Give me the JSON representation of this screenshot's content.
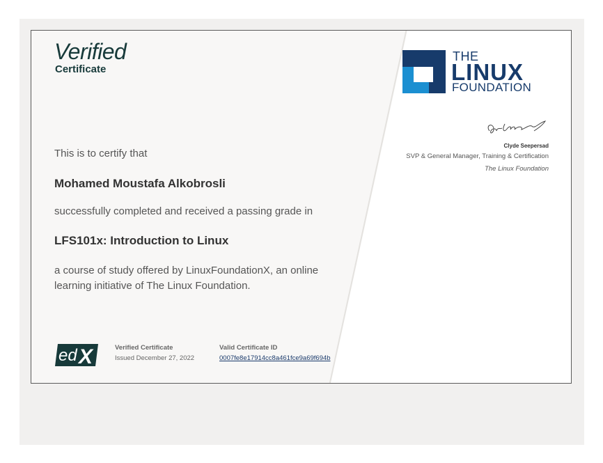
{
  "header": {
    "verified": "Verified",
    "certificate": "Certificate"
  },
  "logo": {
    "the": "THE",
    "linux": "LINUX",
    "foundation": "FOUNDATION",
    "colors": {
      "dark": "#173b6b",
      "light": "#1b8fd1"
    }
  },
  "signatory": {
    "name": "Clyde Seepersad",
    "role": "SVP & General Manager, Training & Certification",
    "org": "The Linux Foundation"
  },
  "body": {
    "certify": "This is to certify that",
    "recipient": "Mohamed Moustafa Alkobrosli",
    "completed": "successfully completed and received a passing grade in",
    "course": "LFS101x: Introduction to Linux",
    "description": "a course of study offered by LinuxFoundationX, an online learning initiative of The Linux Foundation."
  },
  "footer": {
    "edx": "edX",
    "cert_label": "Verified Certificate",
    "issued": "Issued December 27, 2022",
    "id_label": "Valid Certificate ID",
    "cert_id": "0007fe8e17914cc8a461fce9a69f694b"
  }
}
